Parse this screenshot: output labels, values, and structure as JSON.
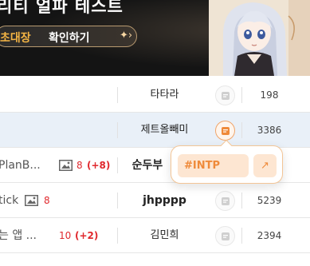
{
  "banner": {
    "title": "리티 얼파 테스트",
    "cta_highlight": "초대장",
    "cta_text": "확인하기"
  },
  "rows": [
    {
      "title": "",
      "comments": "",
      "author": "타타라",
      "views": "198",
      "selected": false
    },
    {
      "title": "",
      "comments": "",
      "author": "제트올빼미",
      "views": "3386",
      "selected": true
    },
    {
      "title": "PlanB...",
      "comments": "8",
      "comments_new": "(+8)",
      "author": "순두부",
      "views": "",
      "selected": false
    },
    {
      "title": "tick",
      "comments": "8",
      "comments_new": "",
      "author": "jhpppp",
      "views": "5239",
      "selected": false
    },
    {
      "title": "는 앱 ...",
      "comments": "10",
      "comments_new": "(+2)",
      "author": "김민희",
      "views": "2394",
      "selected": false
    }
  ],
  "popup": {
    "mbti": "#INTP",
    "link_icon": "arrow-up-right-icon"
  },
  "colors": {
    "accent": "#ef8a3a",
    "comment_red": "#e0282d",
    "selected_row": "#e9f0f8"
  }
}
